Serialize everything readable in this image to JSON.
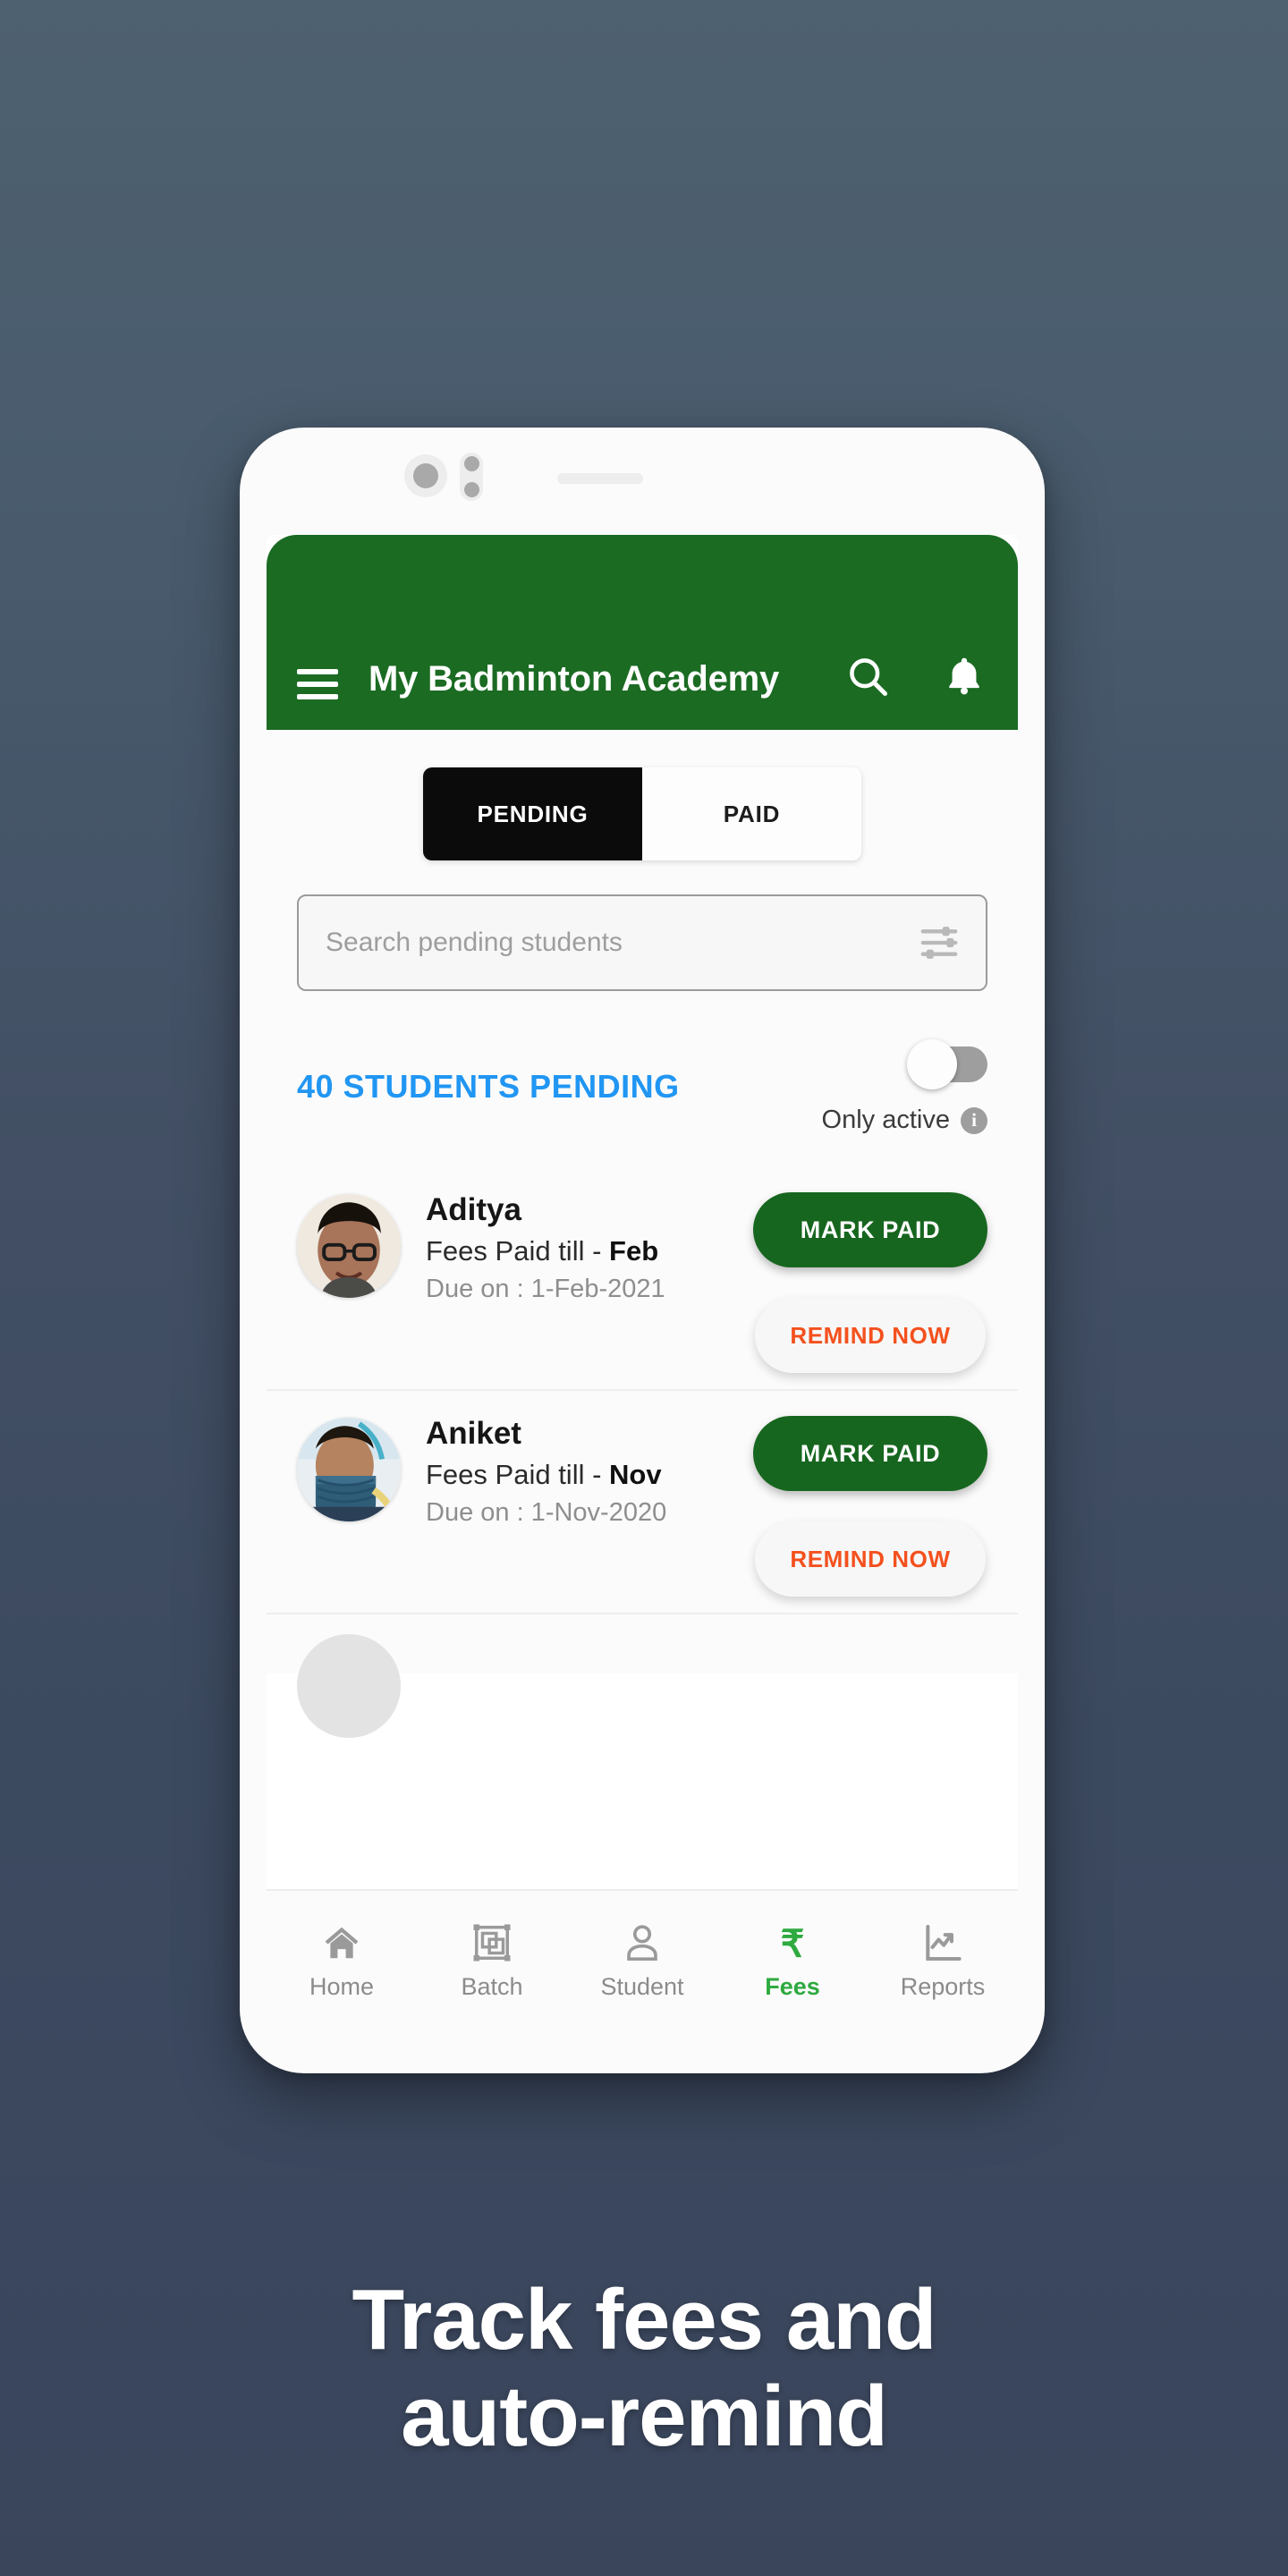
{
  "caption": {
    "line1": "Track fees and",
    "line2": "auto-remind"
  },
  "colors": {
    "app_bar_green": "#1b6b23",
    "accent_blue": "#2196f3",
    "mark_paid_green": "#17661f",
    "remind_orange": "#f4511e",
    "active_nav_green": "#2eaa3f",
    "background_top": "#4e6170",
    "background_bottom": "#3a455c"
  },
  "app_bar": {
    "title": "My Badminton Academy",
    "menu_icon": "hamburger-menu-icon",
    "search_icon": "search-icon",
    "notification_icon": "bell-icon"
  },
  "tabs": [
    {
      "label": "PENDING",
      "active": true
    },
    {
      "label": "PAID",
      "active": false
    }
  ],
  "search": {
    "placeholder": "Search pending students",
    "value": "",
    "filter_icon": "sliders-filter-icon"
  },
  "summary": {
    "pending_count_label": "40 STUDENTS PENDING",
    "toggle_label": "Only active",
    "toggle_on": false,
    "info_icon_char": "i"
  },
  "students": [
    {
      "name": "Aditya",
      "paid_till_prefix": "Fees Paid till - ",
      "paid_till_month": "Feb",
      "due_label": "Due on : 1-Feb-2021",
      "mark_paid_label": "MARK PAID",
      "remind_label": "REMIND NOW"
    },
    {
      "name": "Aniket",
      "paid_till_prefix": "Fees Paid till - ",
      "paid_till_month": "Nov",
      "due_label": "Due on : 1-Nov-2020",
      "mark_paid_label": "MARK PAID",
      "remind_label": "REMIND NOW"
    }
  ],
  "bottom_nav": [
    {
      "label": "Home",
      "icon": "home-icon",
      "active": false
    },
    {
      "label": "Batch",
      "icon": "batch-icon",
      "active": false
    },
    {
      "label": "Student",
      "icon": "person-icon",
      "active": false
    },
    {
      "label": "Fees",
      "icon": "rupee-icon",
      "active": true
    },
    {
      "label": "Reports",
      "icon": "chart-icon",
      "active": false
    }
  ]
}
